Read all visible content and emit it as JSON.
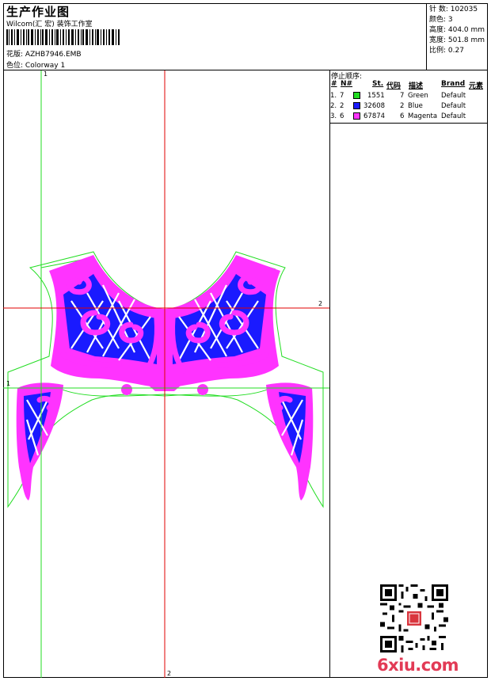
{
  "header": {
    "title": "生产作业图",
    "subtitle": "Wilcom(汇 宏) 装饰工作室",
    "design_label": "花版:",
    "design_value": "AZHB7946.EMB",
    "colorway_label": "色位:",
    "colorway_value": "Colorway 1"
  },
  "stats": {
    "stitches": "针 数: 102035",
    "colors": "颜色: 3",
    "height": "高度: 404.0 mm",
    "width": "宽度: 501.8 mm",
    "scale": "比例: 0.27"
  },
  "stop_sequence": {
    "title": "停止顺序:",
    "headers": [
      "#",
      "N#",
      "St.",
      "代码",
      "描述",
      "Brand",
      "元素"
    ],
    "rows": [
      {
        "idx": "1.",
        "n": "7",
        "color": "#22dd22",
        "st": "1551",
        "code": "7",
        "desc": "Green",
        "brand": "Default"
      },
      {
        "idx": "2.",
        "n": "2",
        "color": "#1a1aff",
        "st": "32608",
        "code": "2",
        "desc": "Blue",
        "brand": "Default"
      },
      {
        "idx": "3.",
        "n": "6",
        "color": "#ff33ff",
        "st": "67874",
        "code": "6",
        "desc": "Magenta",
        "brand": "Default"
      }
    ]
  },
  "guides": {
    "v1_top": "1",
    "h_right": "2",
    "h2_left": "1",
    "v2_bottom": "2"
  },
  "colors": {
    "green": "#22dd22",
    "blue": "#1a1aff",
    "magenta": "#ff33ff",
    "red_guide": "#e00000",
    "watermark": "#e23a55"
  },
  "watermark": "6xiu.com"
}
